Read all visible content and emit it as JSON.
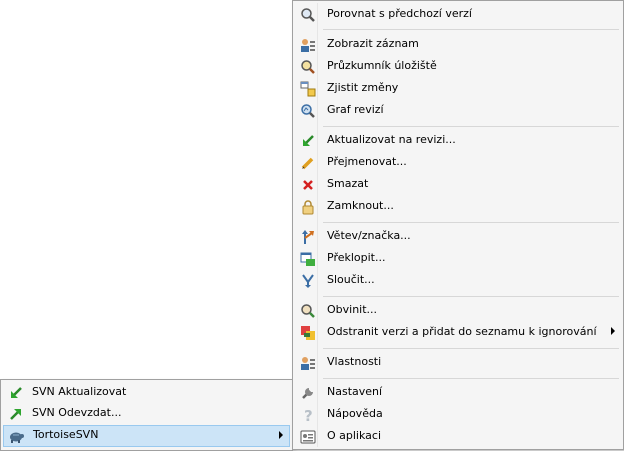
{
  "parent_menu": {
    "items": [
      {
        "label": "SVN Aktualizovat",
        "icon": "svn-update-icon"
      },
      {
        "label": "SVN Odevzdat...",
        "icon": "svn-commit-icon"
      },
      {
        "label": "TortoiseSVN",
        "icon": "tortoise-icon"
      }
    ]
  },
  "submenu": {
    "items": [
      {
        "label": "Porovnat s předchozí verzí",
        "icon": "diff-icon"
      },
      {
        "label": "Zobrazit záznam",
        "icon": "log-icon"
      },
      {
        "label": "Průzkumník úložiště",
        "icon": "repo-browser-icon"
      },
      {
        "label": "Zjistit změny",
        "icon": "check-modifications-icon"
      },
      {
        "label": "Graf revizí",
        "icon": "revision-graph-icon"
      },
      {
        "label": "Aktualizovat na revizi...",
        "icon": "update-revision-icon"
      },
      {
        "label": "Přejmenovat...",
        "icon": "rename-icon"
      },
      {
        "label": "Smazat",
        "icon": "delete-icon"
      },
      {
        "label": "Zamknout...",
        "icon": "lock-icon"
      },
      {
        "label": "Větev/značka...",
        "icon": "branch-tag-icon"
      },
      {
        "label": "Překlopit...",
        "icon": "switch-icon"
      },
      {
        "label": "Sloučit...",
        "icon": "merge-icon"
      },
      {
        "label": "Obvinit...",
        "icon": "blame-icon"
      },
      {
        "label": "Odstranit verzi a přidat do seznamu k ignorování",
        "icon": "ignore-icon"
      },
      {
        "label": "Vlastnosti",
        "icon": "properties-icon"
      },
      {
        "label": "Nastavení",
        "icon": "settings-icon"
      },
      {
        "label": "Nápověda",
        "icon": "help-icon"
      },
      {
        "label": "O aplikaci",
        "icon": "about-icon"
      }
    ]
  }
}
